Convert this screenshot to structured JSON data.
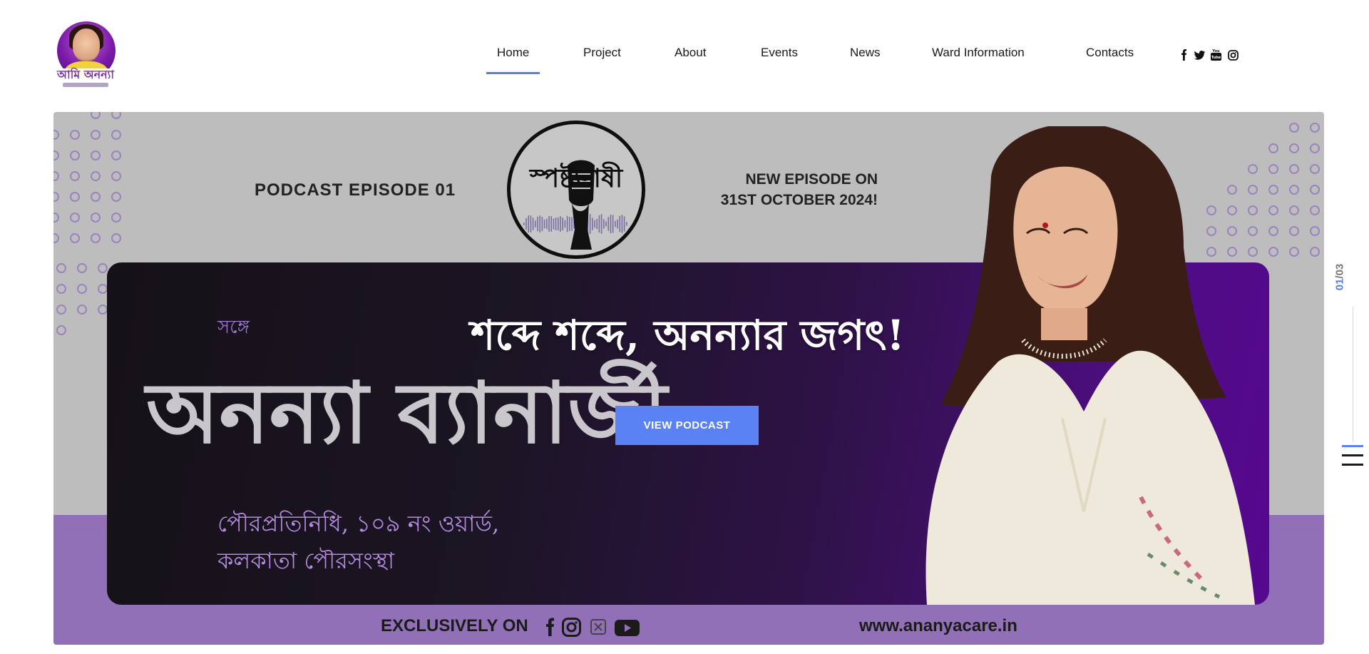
{
  "header": {
    "logo_text": "আমি অনন্যা",
    "nav": [
      "Home",
      "Project",
      "About",
      "Events",
      "News",
      "Ward Information",
      "Contacts"
    ],
    "active_nav": "Home",
    "social_icons": [
      "facebook-icon",
      "twitter-icon",
      "youtube-icon",
      "instagram-icon"
    ]
  },
  "hero": {
    "episode_label": "PODCAST EPISODE 01",
    "new_episode_line1": "NEW EPISODE ON",
    "new_episode_line2": "31ST OCTOBER 2024!",
    "podcast_name": "স্পষ্টভাষী",
    "with_label": "সঙ্গে",
    "slogan": "শব্দে শব্দে, অনন্যার জগৎ!",
    "name": "অনন্যা ব্যানার্জী",
    "role_line1": "পৌরপ্রতিনিধি, ১০৯ নং ওয়ার্ড,",
    "role_line2": "কলকাতা পৌরসংস্থা",
    "button_label": "VIEW PODCAST",
    "exclusively_on": "EXCLUSIVELY ON",
    "platform_icons": [
      "facebook-icon",
      "instagram-icon",
      "x-icon",
      "youtube-icon"
    ],
    "website": "www.ananyacare.in"
  },
  "slider": {
    "current": "01",
    "total": "/03"
  },
  "colors": {
    "accent": "#5a82f5",
    "hero_grey": "#bdbdbd",
    "hero_purple": "#9270b7"
  }
}
